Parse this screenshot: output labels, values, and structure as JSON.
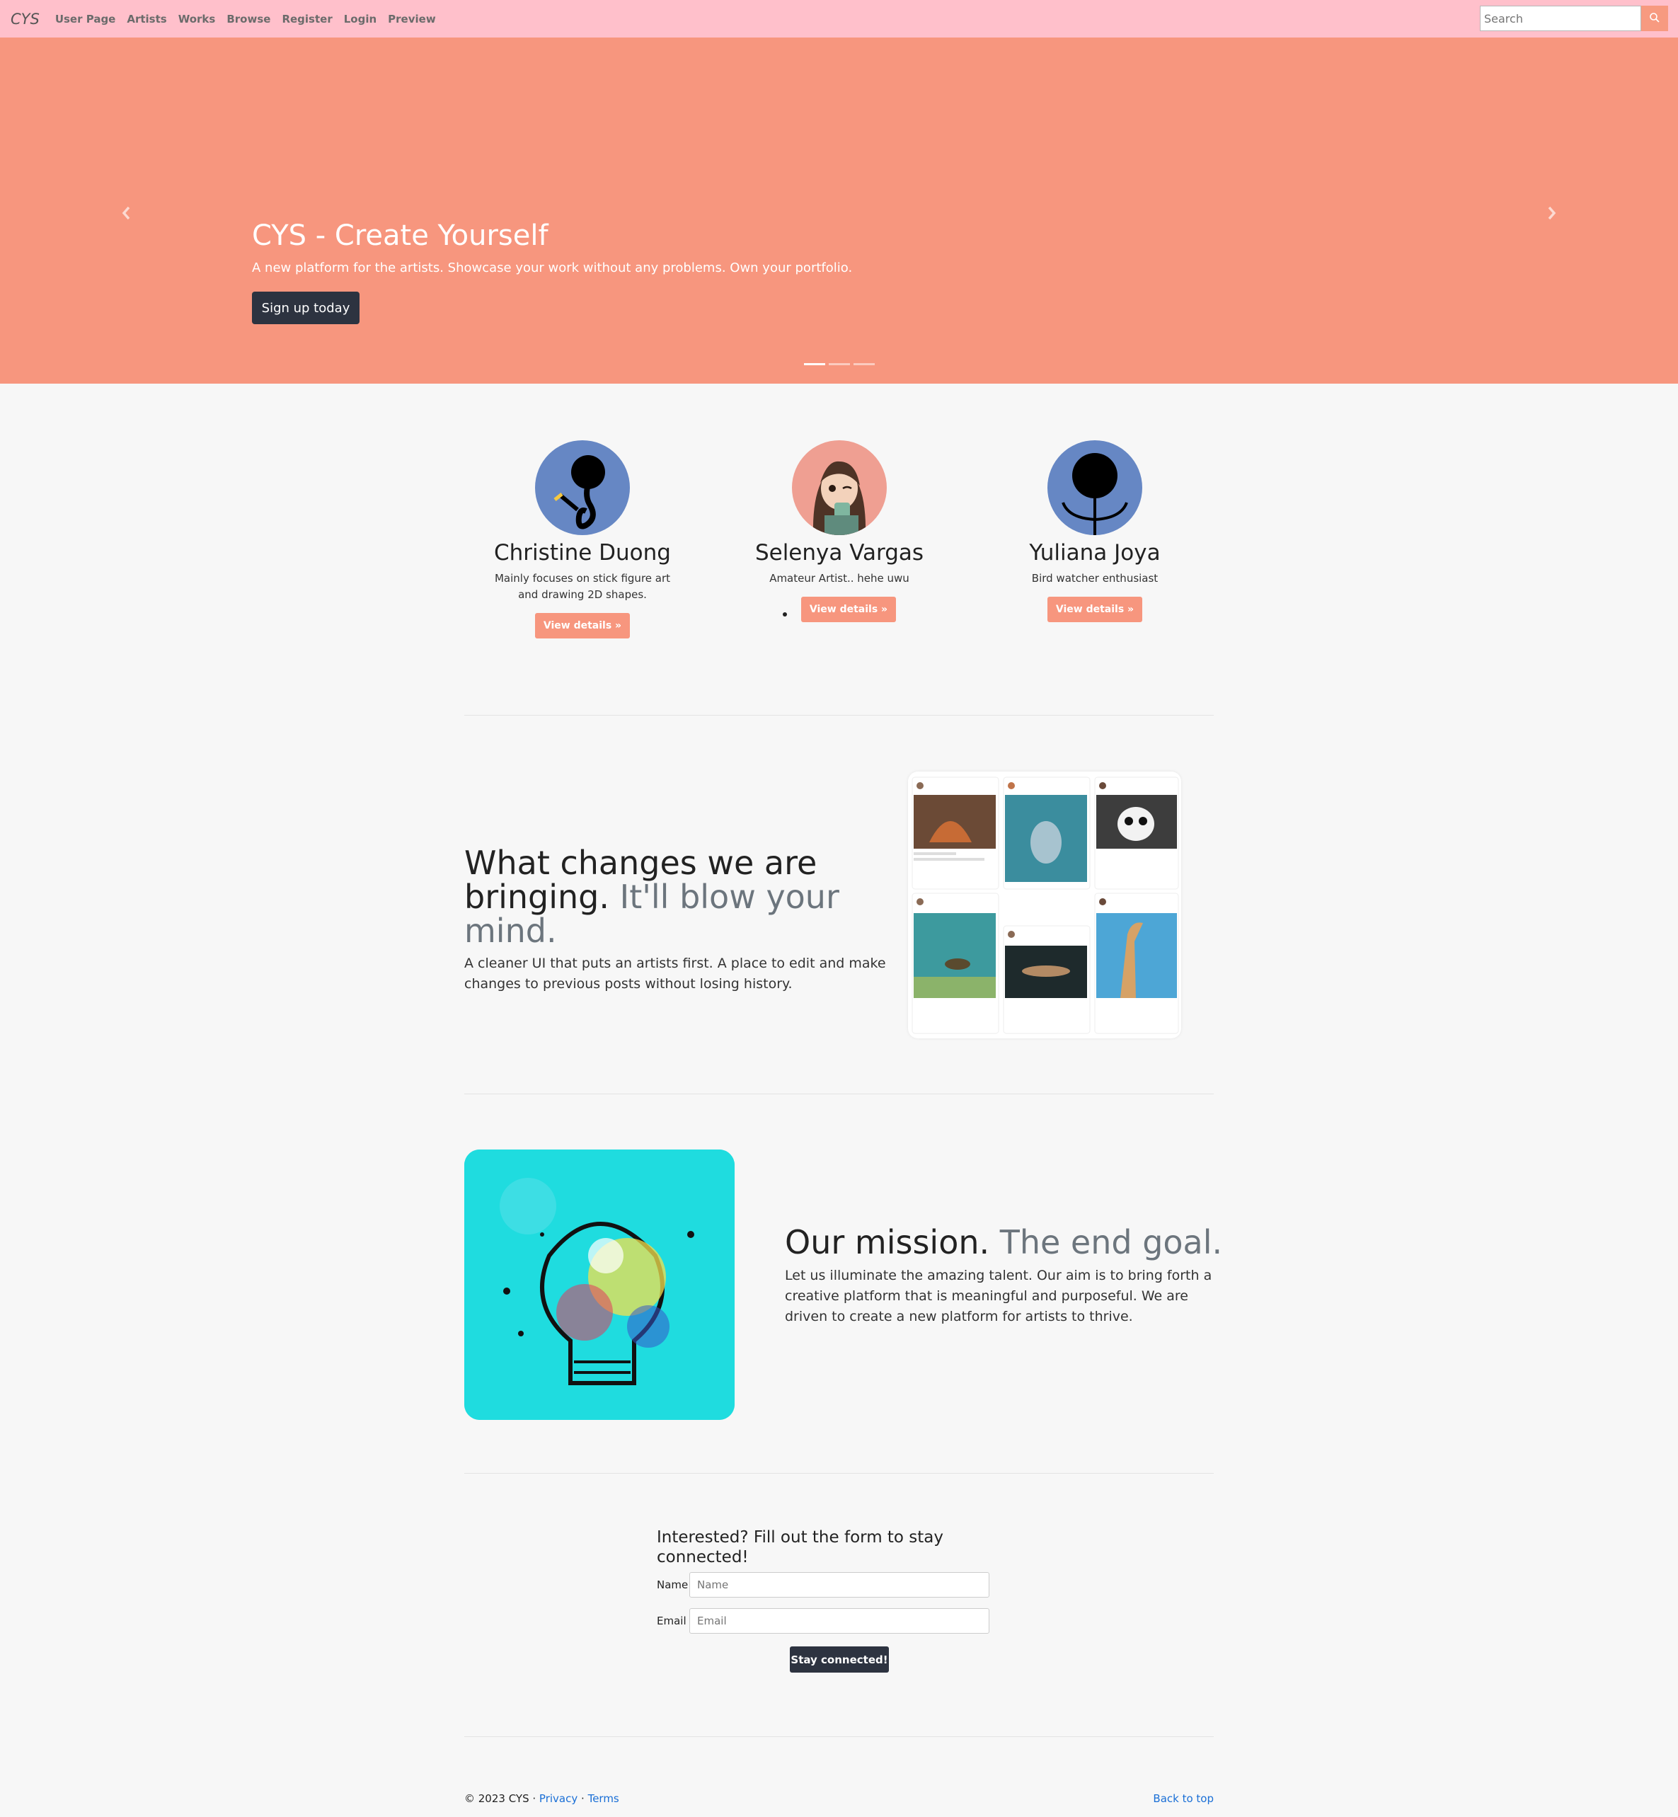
{
  "navbar": {
    "brand": "CYS",
    "links": [
      "User Page",
      "Artists",
      "Works",
      "Browse",
      "Register",
      "Login",
      "Preview"
    ],
    "search_placeholder": "Search",
    "search_icon": "search-icon"
  },
  "hero": {
    "title": "CYS - Create Yourself",
    "subtitle": "A new platform for the artists. Showcase your work without any problems. Own your portfolio.",
    "button": "Sign up today",
    "prev_icon": "chevron-left-icon",
    "next_icon": "chevron-right-icon",
    "slide_count": 3,
    "active_slide": 1
  },
  "artists": [
    {
      "name": "Christine Duong",
      "desc": "Mainly focuses on stick figure art and drawing 2D shapes.",
      "button": "View details »"
    },
    {
      "name": "Selenya Vargas",
      "desc": "Amateur Artist.. hehe uwu",
      "button": "View details »"
    },
    {
      "name": "Yuliana Joya",
      "desc": "Bird watcher enthusiast",
      "button": "View details »"
    }
  ],
  "feature": {
    "heading": "What changes we are bringing.",
    "heading_muted": "It'll blow your mind.",
    "text": "A cleaner UI that puts an artists first. A place to edit and make changes to previous posts without losing history."
  },
  "mission": {
    "heading": "Our mission.",
    "heading_muted": "The end goal.",
    "text": "Let us illuminate the amazing talent. Our aim is to bring forth a creative platform that is meaningful and purposeful. We are driven to create a new platform for artists to thrive."
  },
  "form": {
    "title": "Interested? Fill out the form to stay connected!",
    "name_label": "Name",
    "name_placeholder": "Name",
    "email_label": "Email",
    "email_placeholder": "Email",
    "button": "Stay connected!"
  },
  "footer": {
    "copyright": "© 2023 CYS ·",
    "privacy": "Privacy",
    "sep": "·",
    "terms": "Terms",
    "back_to_top": "Back to top"
  },
  "colors": {
    "navbar": "#ffc0cb",
    "hero": "#f7967e",
    "accent": "#f7967e",
    "dark_button": "#2d3340",
    "link": "#1a6fd6"
  }
}
